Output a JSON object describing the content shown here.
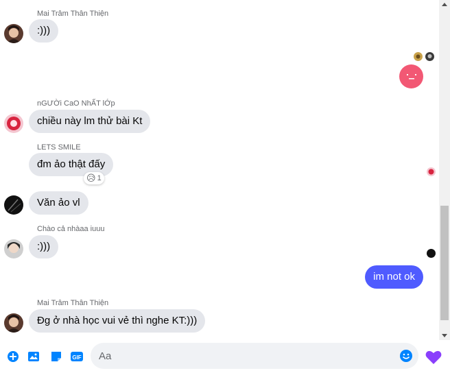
{
  "messages": [
    {
      "sender": "Mai Trâm Thân Thiện",
      "text": ":)))"
    },
    {
      "sender": "nGƯỜi CaO NhẤT lỚp",
      "text": "chiều này lm thử bài Kt"
    },
    {
      "sender": "LETS SMILE",
      "text": "đm ảo thật đấy",
      "reaction": {
        "emoji": "😥",
        "count": "1"
      }
    },
    {
      "sender": "",
      "text": "Văn ảo vl"
    },
    {
      "sender": "Chào cả nhàaa iuuu",
      "text": ":)))"
    },
    {
      "sender": "",
      "text": "im not ok",
      "outgoing": true
    },
    {
      "sender": "Mai Trâm Thân Thiện",
      "text": "Đg ở nhà học vui vẻ thì nghe KT:)))"
    }
  ],
  "composer": {
    "placeholder": "Aa",
    "gif_label": "GIF"
  },
  "colors": {
    "accent": "#0084ff",
    "outgoing_bubble": "#4f5bff",
    "incoming_bubble": "#e4e6eb",
    "sticker": "#f25874",
    "heart": "#8a3ffc"
  },
  "icons": [
    "plus-circle-icon",
    "photo-icon",
    "sticker-icon",
    "gif-icon",
    "emoji-icon",
    "heart-icon"
  ]
}
